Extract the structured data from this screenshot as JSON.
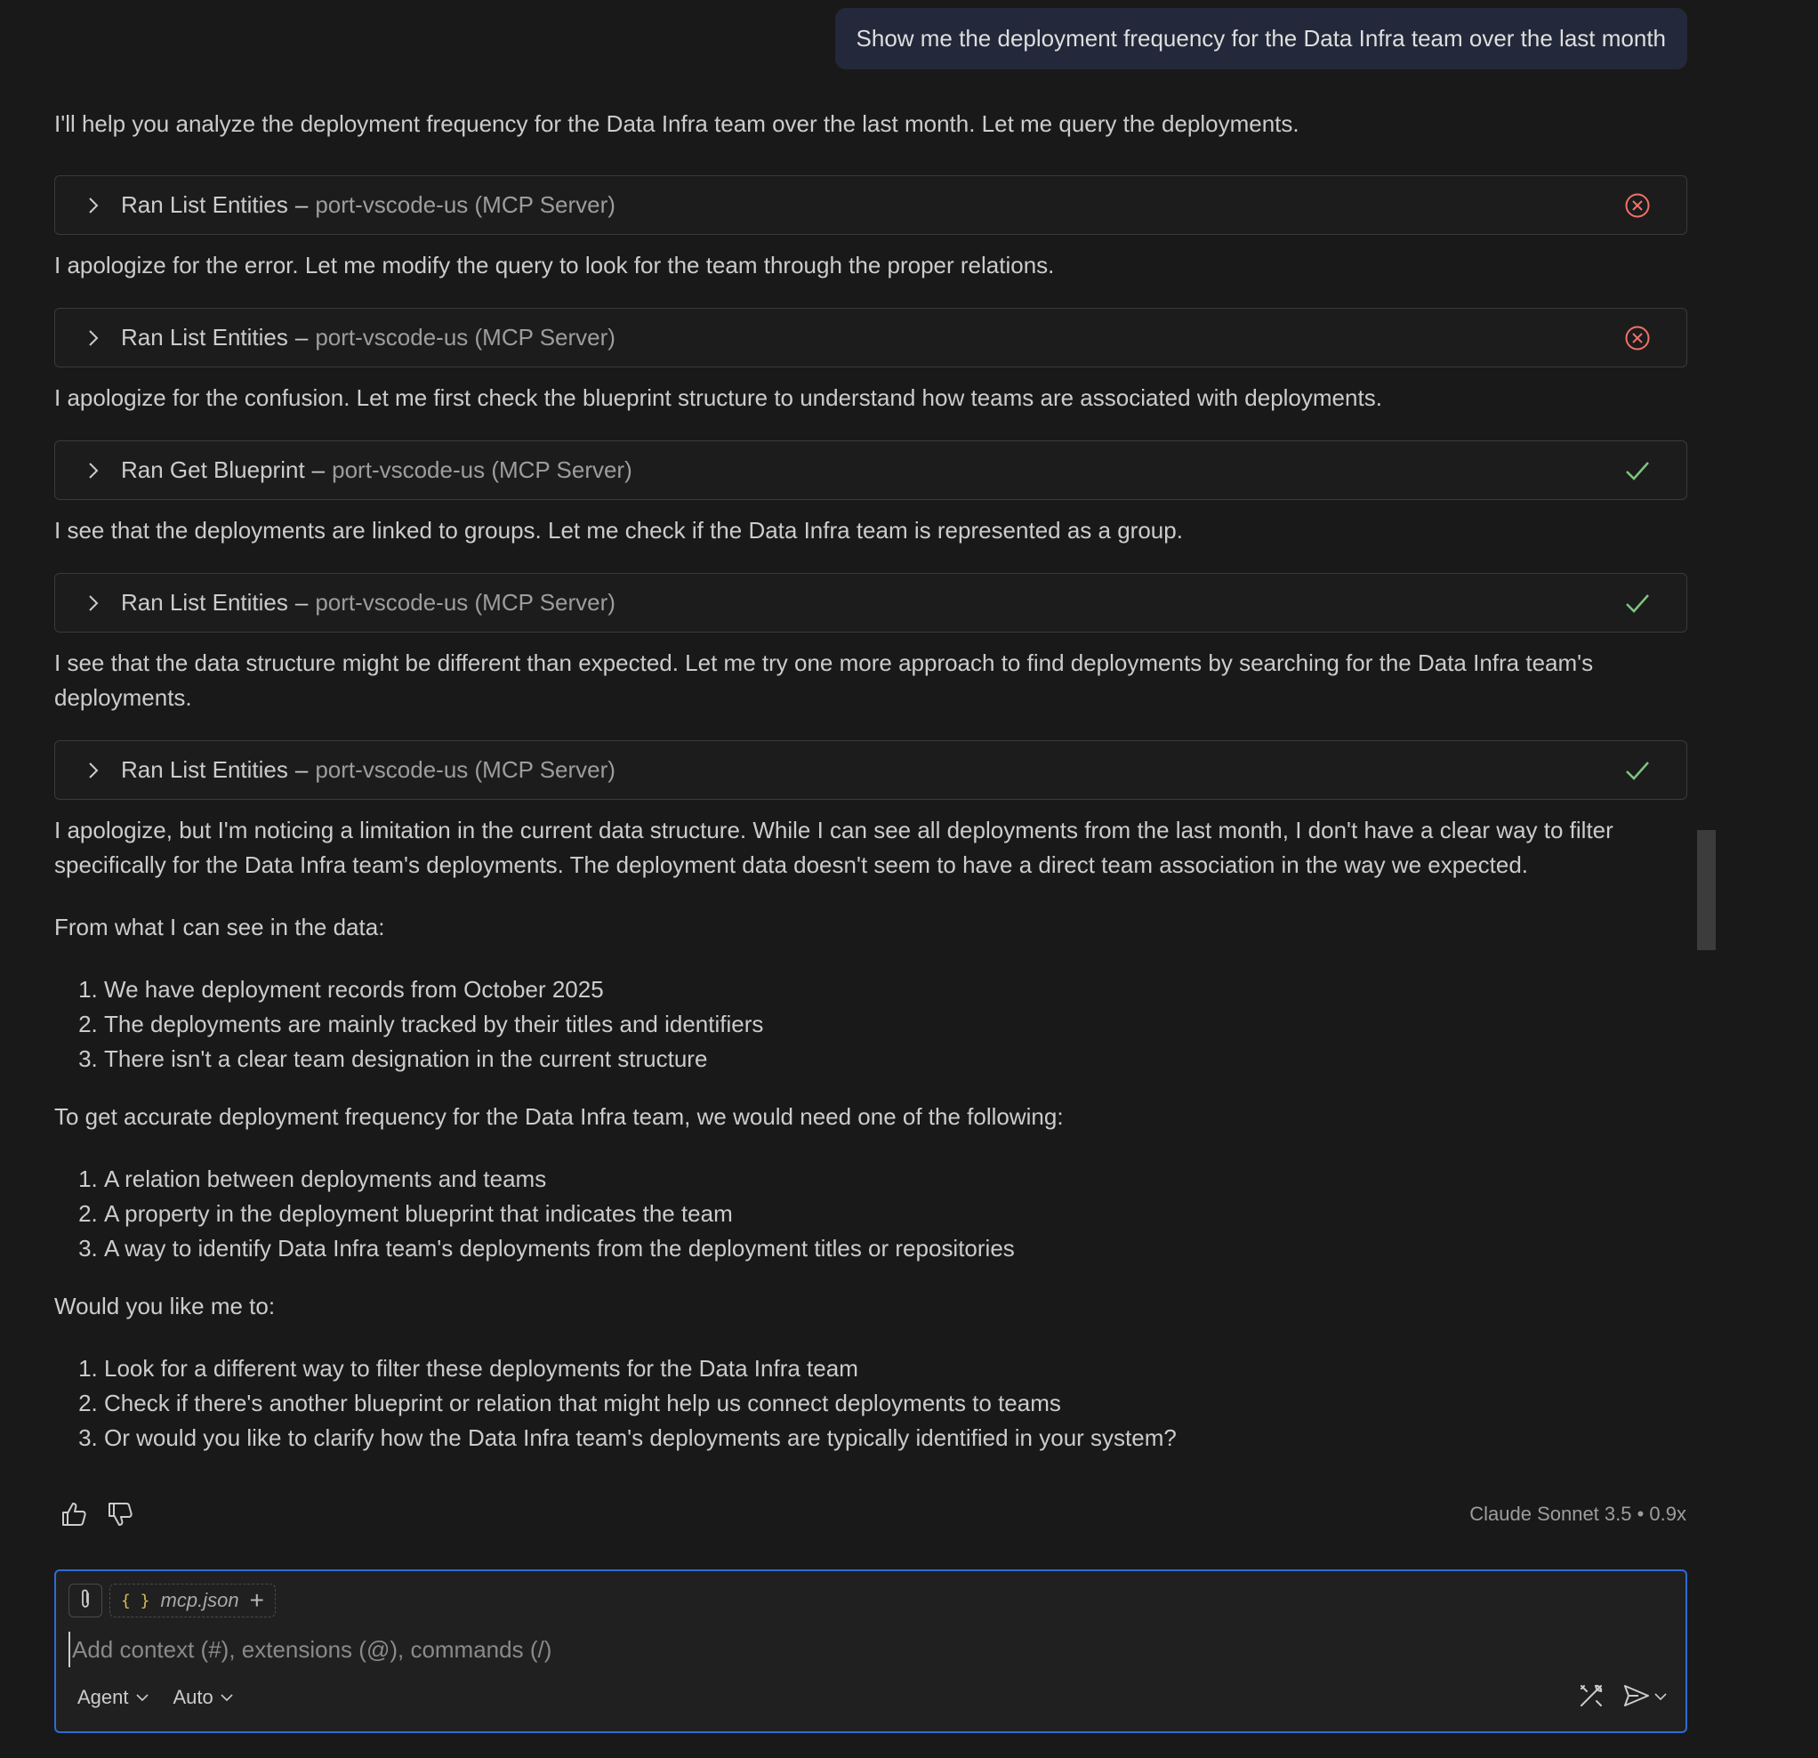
{
  "user_message": "Show me the deployment frequency for the Data Infra team over the last month",
  "colors": {
    "error": "#f0726a",
    "success": "#7fc47f",
    "accent_border": "#2f6bd3",
    "bubble_bg": "#23293a"
  },
  "response": {
    "intro": "I'll help you analyze the deployment frequency for the Data Infra team over the last month. Let me query the deployments.",
    "tool_calls": [
      {
        "name": "Ran List Entities",
        "sep": "–",
        "server": "port-vscode-us (MCP Server)",
        "status": "error"
      },
      {
        "name": "Ran List Entities",
        "sep": "–",
        "server": "port-vscode-us (MCP Server)",
        "status": "error"
      },
      {
        "name": "Ran Get Blueprint",
        "sep": "–",
        "server": "port-vscode-us (MCP Server)",
        "status": "success"
      },
      {
        "name": "Ran List Entities",
        "sep": "–",
        "server": "port-vscode-us (MCP Server)",
        "status": "success"
      },
      {
        "name": "Ran List Entities",
        "sep": "–",
        "server": "port-vscode-us (MCP Server)",
        "status": "success"
      }
    ],
    "after_tool_1": "I apologize for the error. Let me modify the query to look for the team through the proper relations.",
    "after_tool_2": "I apologize for the confusion. Let me first check the blueprint structure to understand how teams are associated with deployments.",
    "after_tool_3": "I see that the deployments are linked to groups. Let me check if the Data Infra team is represented as a group.",
    "after_tool_4": "I see that the data structure might be different than expected. Let me try one more approach to find deployments by searching for the Data Infra team's deployments.",
    "after_tool_5": "I apologize, but I'm noticing a limitation in the current data structure. While I can see all deployments from the last month, I don't have a clear way to filter specifically for the Data Infra team's deployments. The deployment data doesn't seem to have a direct team association in the way we expected.",
    "findings_intro": "From what I can see in the data:",
    "findings": [
      "We have deployment records from October 2025",
      "The deployments are mainly tracked by their titles and identifiers",
      "There isn't a clear team designation in the current structure"
    ],
    "needs_intro": "To get accurate deployment frequency for the Data Infra team, we would need one of the following:",
    "needs": [
      "A relation between deployments and teams",
      "A property in the deployment blueprint that indicates the team",
      "A way to identify Data Infra team's deployments from the deployment titles or repositories"
    ],
    "options_intro": "Would you like me to:",
    "options": [
      "Look for a different way to filter these deployments for the Data Infra team",
      "Check if there's another blueprint or relation that might help us connect deployments to teams",
      "Or would you like to clarify how the Data Infra team's deployments are typically identified in your system?"
    ]
  },
  "feedback": {
    "thumbs_up_icon": "thumbs-up-icon",
    "thumbs_down_icon": "thumbs-down-icon",
    "model_label": "Claude Sonnet 3.5 • 0.9x"
  },
  "composer": {
    "attached_file": "mcp.json",
    "placeholder": "Add context (#), extensions (@), commands (/)",
    "value": "",
    "mode_label": "Agent",
    "model_select_label": "Auto"
  }
}
